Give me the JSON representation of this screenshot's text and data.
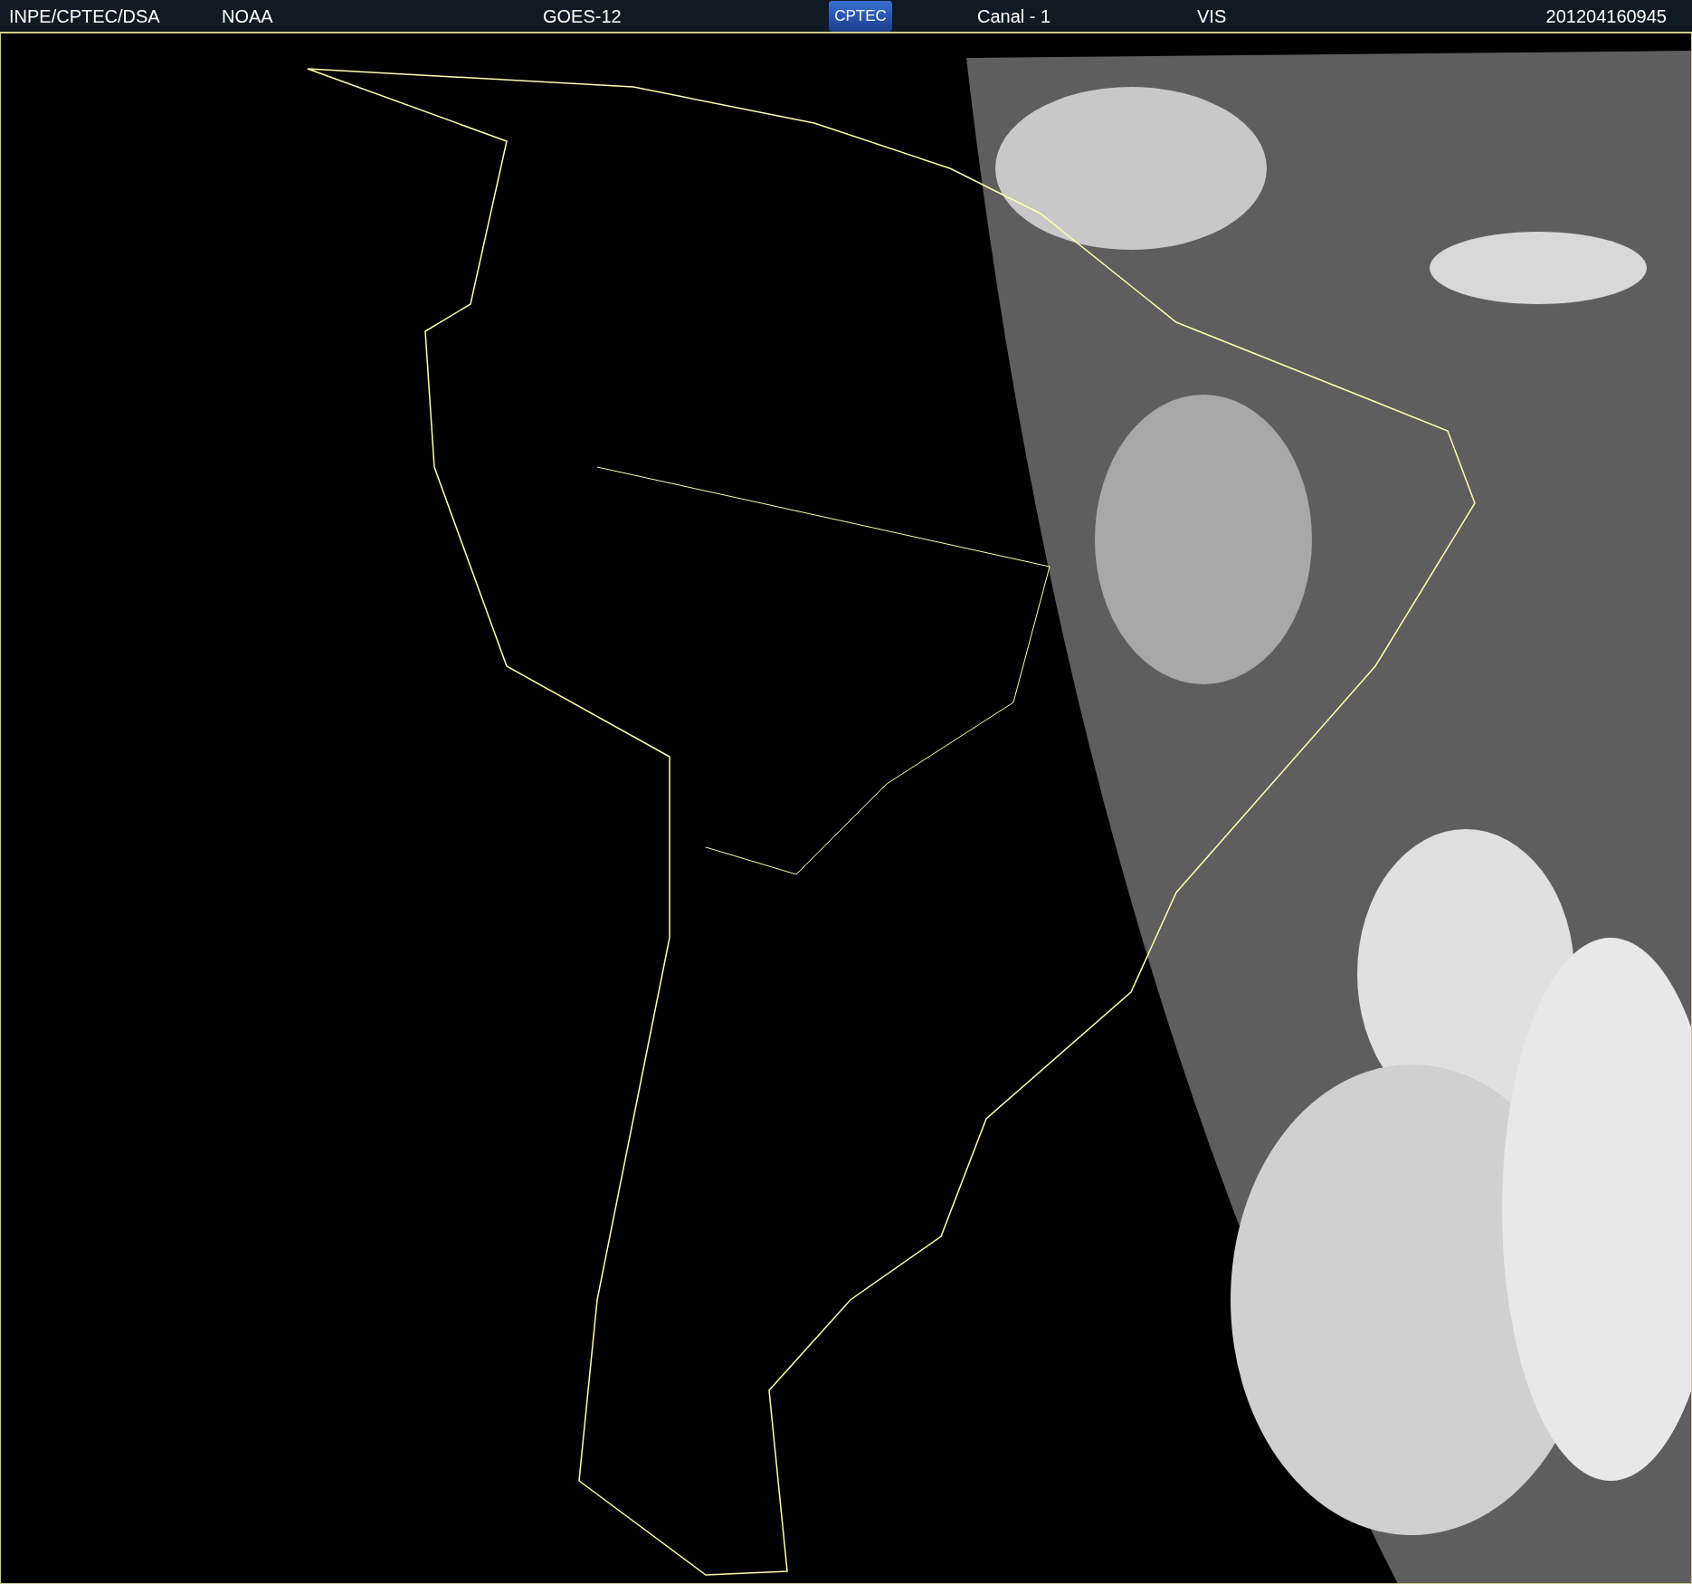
{
  "header": {
    "source": "INPE/CPTEC/DSA",
    "agency": "NOAA",
    "satellite": "GOES-12",
    "logo": "CPTEC",
    "channel": "Canal - 1",
    "band": "VIS",
    "timestamp": "201204160945"
  }
}
